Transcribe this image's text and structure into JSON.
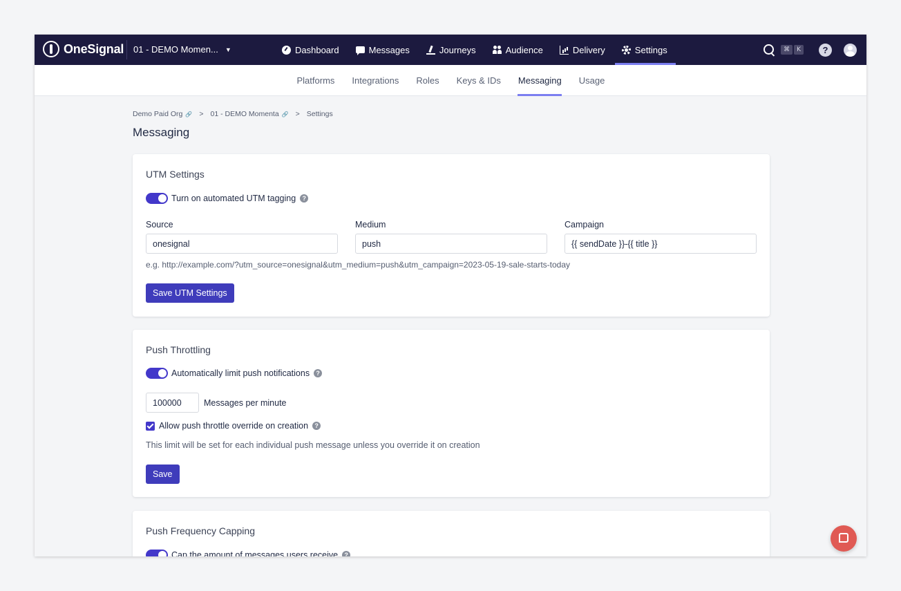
{
  "topnav": {
    "brand": "OneSignal",
    "app_name": "01 - DEMO Momen...",
    "links": [
      {
        "label": "Dashboard",
        "icon": "dashboard-icon"
      },
      {
        "label": "Messages",
        "icon": "message-icon"
      },
      {
        "label": "Journeys",
        "icon": "journeys-icon"
      },
      {
        "label": "Audience",
        "icon": "audience-icon"
      },
      {
        "label": "Delivery",
        "icon": "delivery-icon"
      },
      {
        "label": "Settings",
        "icon": "gear-icon"
      }
    ],
    "active": "Settings",
    "shortcut_keys": [
      "⌘",
      "K"
    ],
    "help": "?"
  },
  "subnav": {
    "tabs": [
      "Platforms",
      "Integrations",
      "Roles",
      "Keys & IDs",
      "Messaging",
      "Usage"
    ],
    "active": "Messaging"
  },
  "breadcrumb": {
    "items": [
      "Demo Paid Org",
      "01 - DEMO Momenta",
      "Settings"
    ],
    "separator": ">"
  },
  "page": {
    "title": "Messaging"
  },
  "utm": {
    "title": "UTM Settings",
    "toggle_label": "Turn on automated UTM tagging",
    "toggle_on": true,
    "source_label": "Source",
    "source_value": "onesignal",
    "medium_label": "Medium",
    "medium_value": "push",
    "campaign_label": "Campaign",
    "campaign_value": "{{ sendDate }}-{{ title }}",
    "example": "e.g. http://example.com/?utm_source=onesignal&utm_medium=push&utm_campaign=2023-05-19-sale-starts-today",
    "save_label": "Save UTM Settings"
  },
  "throttle": {
    "title": "Push Throttling",
    "toggle_label": "Automatically limit push notifications",
    "toggle_on": true,
    "rate_value": "100000",
    "rate_unit": "Messages per minute",
    "override_label": "Allow push throttle override on creation",
    "override_checked": true,
    "note": "This limit will be set for each individual push message unless you override it on creation",
    "save_label": "Save"
  },
  "capping": {
    "title": "Push Frequency Capping",
    "toggle_label": "Cap the amount of messages users receive",
    "toggle_on": true
  },
  "colors": {
    "nav_bg": "#1c1a3f",
    "accent": "#4338ca",
    "tab_indicator": "#7b7ef0",
    "chat": "#e05a54"
  }
}
